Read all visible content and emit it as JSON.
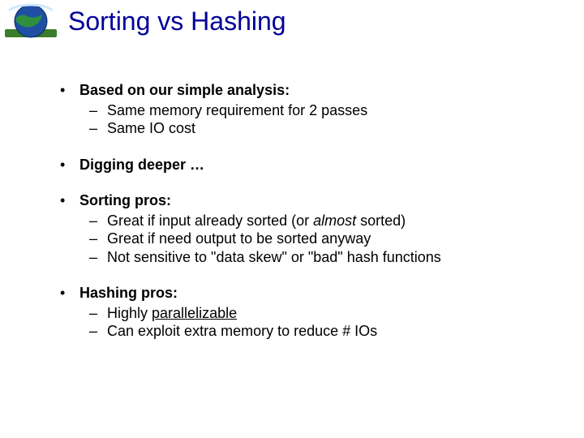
{
  "title": "Sorting vs Hashing",
  "bullets": [
    {
      "lead": "Based on our simple analysis:",
      "subs": [
        {
          "text": "Same memory requirement for 2 passes"
        },
        {
          "text": "Same IO cost"
        }
      ]
    },
    {
      "lead": "Digging deeper …",
      "subs": []
    },
    {
      "lead": "Sorting pros:",
      "subs": [
        {
          "pre": "Great if input already sorted (or ",
          "italic": "almost",
          "post": " sorted)"
        },
        {
          "text": "Great if need output to be sorted anyway"
        },
        {
          "text": "Not sensitive to \"data skew\" or \"bad\" hash functions"
        }
      ]
    },
    {
      "lead": "Hashing pros:",
      "subs": [
        {
          "pre": "Highly ",
          "underline": "parallelizable",
          "post": ""
        },
        {
          "text": "Can exploit extra memory to reduce # IOs"
        }
      ]
    }
  ]
}
